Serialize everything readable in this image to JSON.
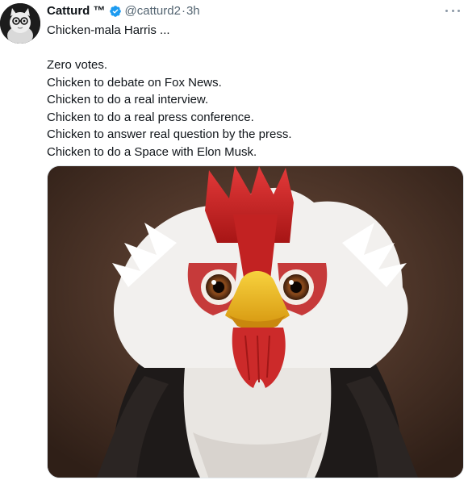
{
  "tweet": {
    "display_name": "Catturd ™",
    "handle": "@catturd2",
    "separator": "·",
    "time": "3h",
    "lines": [
      "Chicken-mala Harris ...",
      "",
      "Zero votes.",
      "Chicken to debate on Fox News.",
      "Chicken to do a real interview.",
      "Chicken to do a real press conference.",
      "Chicken to answer real question by the press.",
      "Chicken to do a Space with Elon Musk."
    ],
    "verified_color": "#1d9bf0",
    "muted_color": "#536471"
  },
  "icons": {
    "verified": "verified-badge-icon",
    "more": "more-dots-icon"
  }
}
